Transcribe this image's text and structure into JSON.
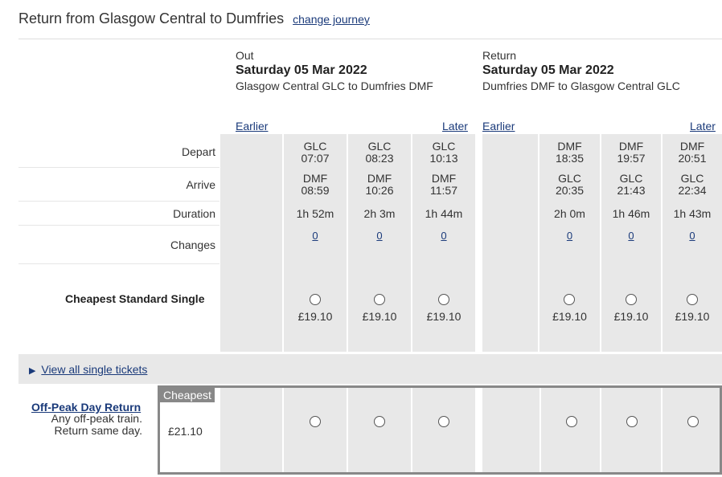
{
  "header": {
    "title": "Return from Glasgow Central to Dumfries",
    "change_link": "change journey"
  },
  "out": {
    "label": "Out",
    "date": "Saturday 05 Mar 2022",
    "route": "Glasgow Central GLC to Dumfries DMF",
    "earlier": "Earlier",
    "later": "Later",
    "trains": [
      {
        "dep_station": "GLC",
        "dep_time": "07:07",
        "arr_station": "DMF",
        "arr_time": "08:59",
        "duration": "1h 52m",
        "changes": "0",
        "price": "£19.10"
      },
      {
        "dep_station": "GLC",
        "dep_time": "08:23",
        "arr_station": "DMF",
        "arr_time": "10:26",
        "duration": "2h 3m",
        "changes": "0",
        "price": "£19.10"
      },
      {
        "dep_station": "GLC",
        "dep_time": "10:13",
        "arr_station": "DMF",
        "arr_time": "11:57",
        "duration": "1h 44m",
        "changes": "0",
        "price": "£19.10"
      }
    ]
  },
  "return": {
    "label": "Return",
    "date": "Saturday 05 Mar 2022",
    "route": "Dumfries DMF to Glasgow Central GLC",
    "earlier": "Earlier",
    "later": "Later",
    "trains": [
      {
        "dep_station": "DMF",
        "dep_time": "18:35",
        "arr_station": "GLC",
        "arr_time": "20:35",
        "duration": "2h 0m",
        "changes": "0",
        "price": "£19.10"
      },
      {
        "dep_station": "DMF",
        "dep_time": "19:57",
        "arr_station": "GLC",
        "arr_time": "21:43",
        "duration": "1h 46m",
        "changes": "0",
        "price": "£19.10"
      },
      {
        "dep_station": "DMF",
        "dep_time": "20:51",
        "arr_station": "GLC",
        "arr_time": "22:34",
        "duration": "1h 43m",
        "changes": "0",
        "price": "£19.10"
      }
    ]
  },
  "rows": {
    "depart": "Depart",
    "arrive": "Arrive",
    "duration": "Duration",
    "changes": "Changes"
  },
  "single": {
    "label": "Cheapest Standard Single"
  },
  "view_all": {
    "label": "View all single tickets"
  },
  "offpeak": {
    "title": "Off-Peak Day Return",
    "desc1": "Any off-peak train.",
    "desc2": "Return same day.",
    "badge": "Cheapest",
    "price": "£21.10"
  }
}
